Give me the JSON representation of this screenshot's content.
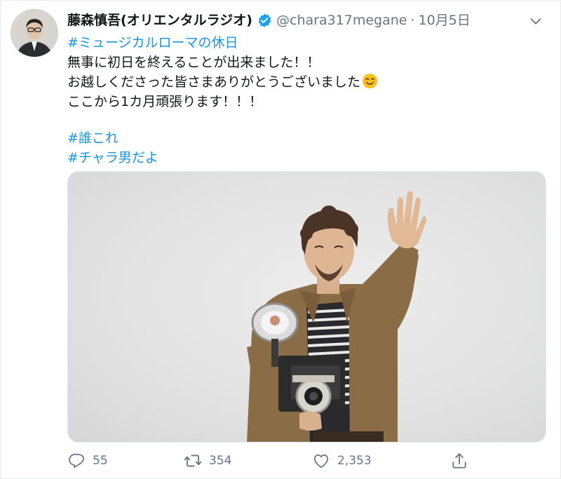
{
  "author": {
    "display_name": "藤森慎吾(オリエンタルラジオ)",
    "handle": "@chara317megane",
    "separator": "·",
    "date": "10月5日",
    "verified_color": "#1da1f2"
  },
  "tweet": {
    "hashtag1": "#ミュージカルローマの休日",
    "line1": "無事に初日を終えることが出来ました！！",
    "line2": "お越しくださった皆さまありがとうございました",
    "line2_emoji": "smiling-face-icon",
    "line3": "ここから1カ月頑張ります！！！",
    "hashtag2": "#誰これ",
    "hashtag3": "#チャラ男だよ"
  },
  "actions": {
    "reply_count": "55",
    "retweet_count": "354",
    "like_count": "2,353",
    "reply_icon": "reply-icon",
    "retweet_icon": "retweet-icon",
    "like_icon": "heart-icon",
    "share_icon": "share-icon"
  },
  "colors": {
    "link": "#1b95e0",
    "muted": "#657786",
    "text": "#14171a"
  }
}
